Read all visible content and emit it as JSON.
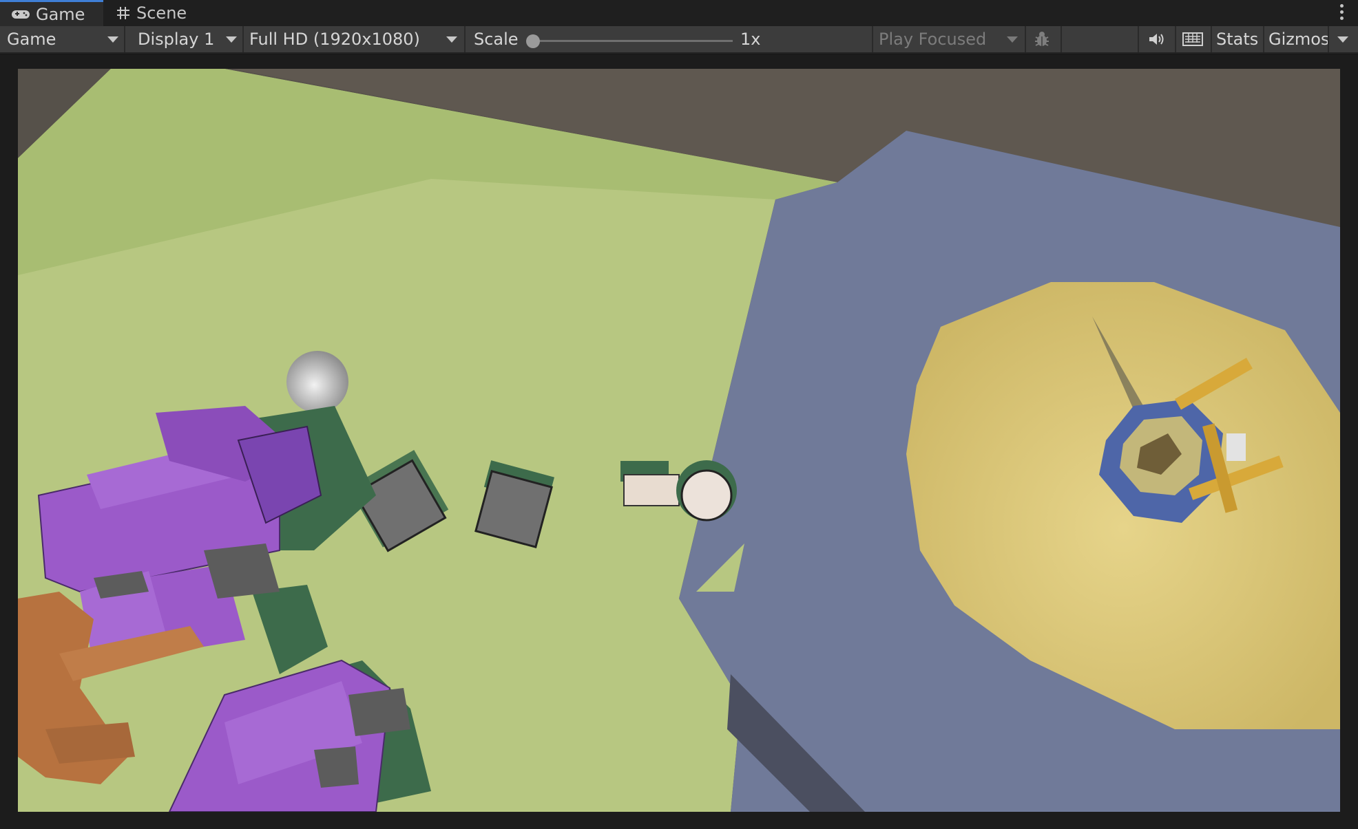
{
  "tabs": [
    {
      "label": "Game",
      "icon": "gamepad-icon",
      "active": true
    },
    {
      "label": "Scene",
      "icon": "grid-hash-icon",
      "active": false
    }
  ],
  "toolbar": {
    "view_mode": "Game",
    "display": "Display 1",
    "resolution": "Full HD (1920x1080)",
    "scale_label": "Scale",
    "scale_value": "1x",
    "play_mode": "Play Focused",
    "stats": "Stats",
    "gizmos": "Gizmos"
  },
  "icons": {
    "bug": "bug-icon",
    "audio": "speaker-icon",
    "keyboard": "keyboard-icon",
    "more": "kebab-menu-icon"
  },
  "colors": {
    "tab_accent": "#3f7fd6",
    "ground_green": "#b8c983",
    "ground_blue": "#717b9a",
    "ground_yellow": "#d9c475",
    "enemy_purple": "#9b5ac9",
    "crate_gray": "#707070"
  }
}
